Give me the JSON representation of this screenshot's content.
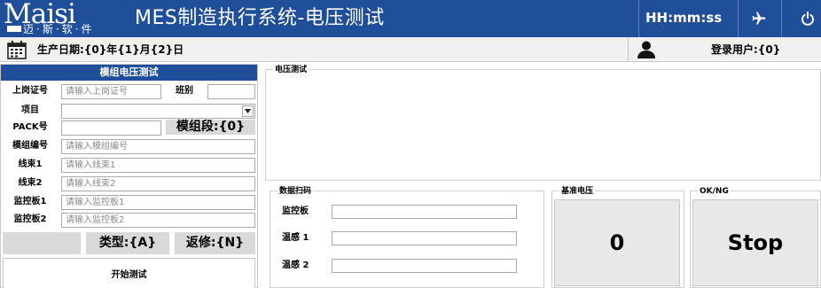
{
  "header": {
    "logo_text": "Maisi",
    "logo_subtitle": "迈·斯·软·件",
    "title": "MES制造执行系统-电压测试",
    "clock": "HH:mm:ss",
    "icons": {
      "airplane": "airplane-icon",
      "power": "power-icon"
    }
  },
  "infobar": {
    "production_date": "生产日期:{0}年{1}月{2}日",
    "login_user": "登录用户:{0}",
    "icons": {
      "calendar": "calendar-icon",
      "user": "user-icon"
    }
  },
  "left_panel": {
    "title": "模组电压测试",
    "fields": {
      "post_cert": {
        "label": "上岗证号",
        "placeholder": "请输入上岗证号",
        "value": ""
      },
      "shift": {
        "label": "班别",
        "value": ""
      },
      "project": {
        "label": "项目",
        "value": ""
      },
      "pack": {
        "label": "PACK号",
        "value": ""
      },
      "segment": "模组段:{0}",
      "module_no": {
        "label": "模组编号",
        "placeholder": "请输入模组编号",
        "value": ""
      },
      "harness1": {
        "label": "线束1",
        "placeholder": "请输入线束1",
        "value": ""
      },
      "harness2": {
        "label": "线束2",
        "placeholder": "请输入线束2",
        "value": ""
      },
      "monitor1": {
        "label": "监控板1",
        "placeholder": "请输入监控板1",
        "value": ""
      },
      "monitor2": {
        "label": "监控板2",
        "placeholder": "请输入监控板2",
        "value": ""
      }
    },
    "type_label": "类型:{A}",
    "rework_label": "返修:{N}",
    "start_button": "开始测试"
  },
  "voltage_test": {
    "title": "电压测试"
  },
  "data_scan": {
    "title": "数据扫码",
    "monitor_board": "监控板",
    "temp1": "温感 1",
    "temp2": "温感 2"
  },
  "reference_voltage": {
    "title": "基准电压",
    "value": "0"
  },
  "ok_ng": {
    "title": "OK/NG",
    "value": "Stop"
  },
  "colors": {
    "header_bg": "#1f4e9a",
    "panel_gray": "#d9d9d9",
    "logo_accent": "#e3262b"
  }
}
